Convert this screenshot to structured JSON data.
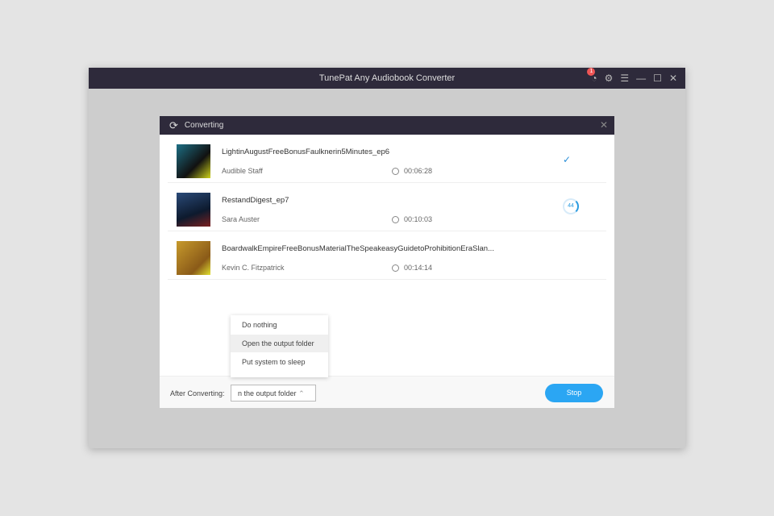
{
  "app": {
    "title": "TunePat Any Audiobook Converter",
    "notification_count": "1"
  },
  "dialog": {
    "title": "Converting",
    "items": [
      {
        "title": "LightinAugustFreeBonusFaulknerin5Minutes_ep6",
        "author": "Audible Staff",
        "duration": "00:06:28",
        "status": "done"
      },
      {
        "title": "RestandDigest_ep7",
        "author": "Sara Auster",
        "duration": "00:10:03",
        "status": "progress",
        "progress": "44"
      },
      {
        "title": "BoardwalkEmpireFreeBonusMaterialTheSpeakeasyGuidetoProhibitionEraSlan...",
        "author": "Kevin C. Fitzpatrick",
        "duration": "00:14:14",
        "status": "pending"
      }
    ],
    "after_label": "After Converting:",
    "after_value": "n the output folder",
    "stop_label": "Stop",
    "options": [
      "Do nothing",
      "Open the output folder",
      "Put system to sleep"
    ]
  }
}
